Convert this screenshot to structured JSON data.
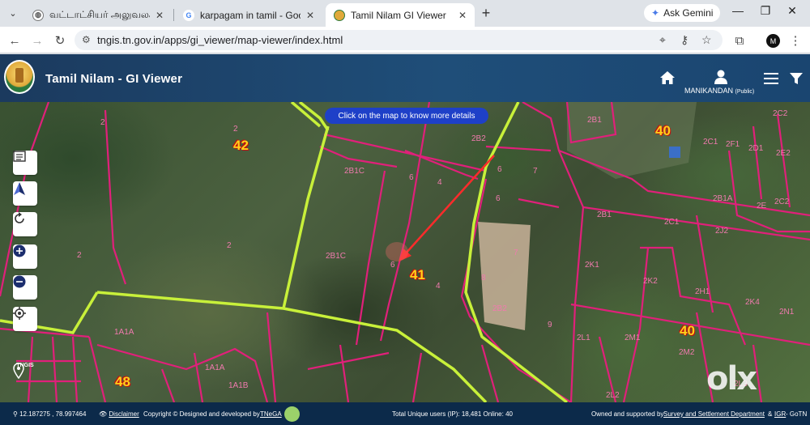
{
  "browser": {
    "tabs": [
      {
        "title": "வட்டாட்சியர் அலுவலக ஜ",
        "favicon": "globe-icon",
        "active": false
      },
      {
        "title": "karpagam in tamil - Google Sea",
        "favicon": "google-icon",
        "active": false
      },
      {
        "title": "Tamil Nilam GI Viewer",
        "favicon": "tn-emblem-icon",
        "active": true
      }
    ],
    "ask_gemini": "Ask Gemini",
    "url": "tngis.tn.gov.in/apps/gi_viewer/map-viewer/index.html",
    "profile_initial": "M"
  },
  "app": {
    "title": "Tamil Nilam - GI Viewer",
    "user_name": "MANIKANDAN",
    "user_role": "(Public)"
  },
  "map": {
    "info_pill": "Click on the map to know more details",
    "survey_numbers": [
      {
        "label": "42",
        "kind": "major"
      },
      {
        "label": "41",
        "kind": "major"
      },
      {
        "label": "40",
        "kind": "major"
      },
      {
        "label": "40",
        "kind": "major"
      },
      {
        "label": "48",
        "kind": "major"
      },
      {
        "label": "2",
        "kind": "minor"
      },
      {
        "label": "2",
        "kind": "minor"
      },
      {
        "label": "2",
        "kind": "minor"
      },
      {
        "label": "2",
        "kind": "minor"
      },
      {
        "label": "2B1C",
        "kind": "minor"
      },
      {
        "label": "2B1C",
        "kind": "minor"
      },
      {
        "label": "6",
        "kind": "minor"
      },
      {
        "label": "4",
        "kind": "minor"
      },
      {
        "label": "6",
        "kind": "minor"
      },
      {
        "label": "4",
        "kind": "minor"
      },
      {
        "label": "2B2",
        "kind": "minor"
      },
      {
        "label": "6",
        "kind": "minor"
      },
      {
        "label": "7",
        "kind": "minor"
      },
      {
        "label": "6",
        "kind": "minor"
      },
      {
        "label": "7",
        "kind": "minor"
      },
      {
        "label": "8",
        "kind": "minor"
      },
      {
        "label": "2B2",
        "kind": "minor"
      },
      {
        "label": "9",
        "kind": "minor"
      },
      {
        "label": "1A1A",
        "kind": "minor"
      },
      {
        "label": "1A1A",
        "kind": "minor"
      },
      {
        "label": "1A1B",
        "kind": "minor"
      },
      {
        "label": "2B1",
        "kind": "minor"
      },
      {
        "label": "2C1",
        "kind": "minor"
      },
      {
        "label": "2D1",
        "kind": "minor"
      },
      {
        "label": "2E2",
        "kind": "minor"
      },
      {
        "label": "2F1",
        "kind": "minor"
      },
      {
        "label": "2C2",
        "kind": "minor"
      },
      {
        "label": "2C1",
        "kind": "minor"
      },
      {
        "label": "2B1",
        "kind": "minor"
      },
      {
        "label": "2J2",
        "kind": "minor"
      },
      {
        "label": "2K1",
        "kind": "minor"
      },
      {
        "label": "2K2",
        "kind": "minor"
      },
      {
        "label": "2H1",
        "kind": "minor"
      },
      {
        "label": "2L1",
        "kind": "minor"
      },
      {
        "label": "2M1",
        "kind": "minor"
      },
      {
        "label": "2M2",
        "kind": "minor"
      },
      {
        "label": "2K4",
        "kind": "minor"
      },
      {
        "label": "2N1",
        "kind": "minor"
      },
      {
        "label": "2L2",
        "kind": "minor"
      },
      {
        "label": "2L3",
        "kind": "minor"
      },
      {
        "label": "2B1A",
        "kind": "minor"
      },
      {
        "label": "2E",
        "kind": "minor"
      },
      {
        "label": "2C2",
        "kind": "minor"
      }
    ],
    "watermark": "olx"
  },
  "footer": {
    "coordinates": "12.187275 , 78.997464",
    "disclaimer": "Disclaimer",
    "copyright": "Copyright © Designed and developed by",
    "tnega": "TNeGA",
    "users": "Total Unique users (IP): 18,481 Online: 40",
    "owned_prefix": "Owned and supported by",
    "survey_dept": "Survey and Settlement Department",
    "amp": "&",
    "igr": "IGR",
    "gotn": "- GoTN"
  },
  "colors": {
    "app_header": "#1f4e79",
    "footer": "#0c2a4a",
    "parcel_line": "#e0207a",
    "boundary_line": "#c8f03a",
    "major_label": "#ffd21a",
    "pill": "#1e40c8"
  },
  "map_controls": [
    "layers-list-icon",
    "north-arrow-icon",
    "refresh-icon",
    "zoom-in-icon",
    "zoom-out-icon",
    "locate-icon"
  ],
  "tngis_label": "TNGIS"
}
